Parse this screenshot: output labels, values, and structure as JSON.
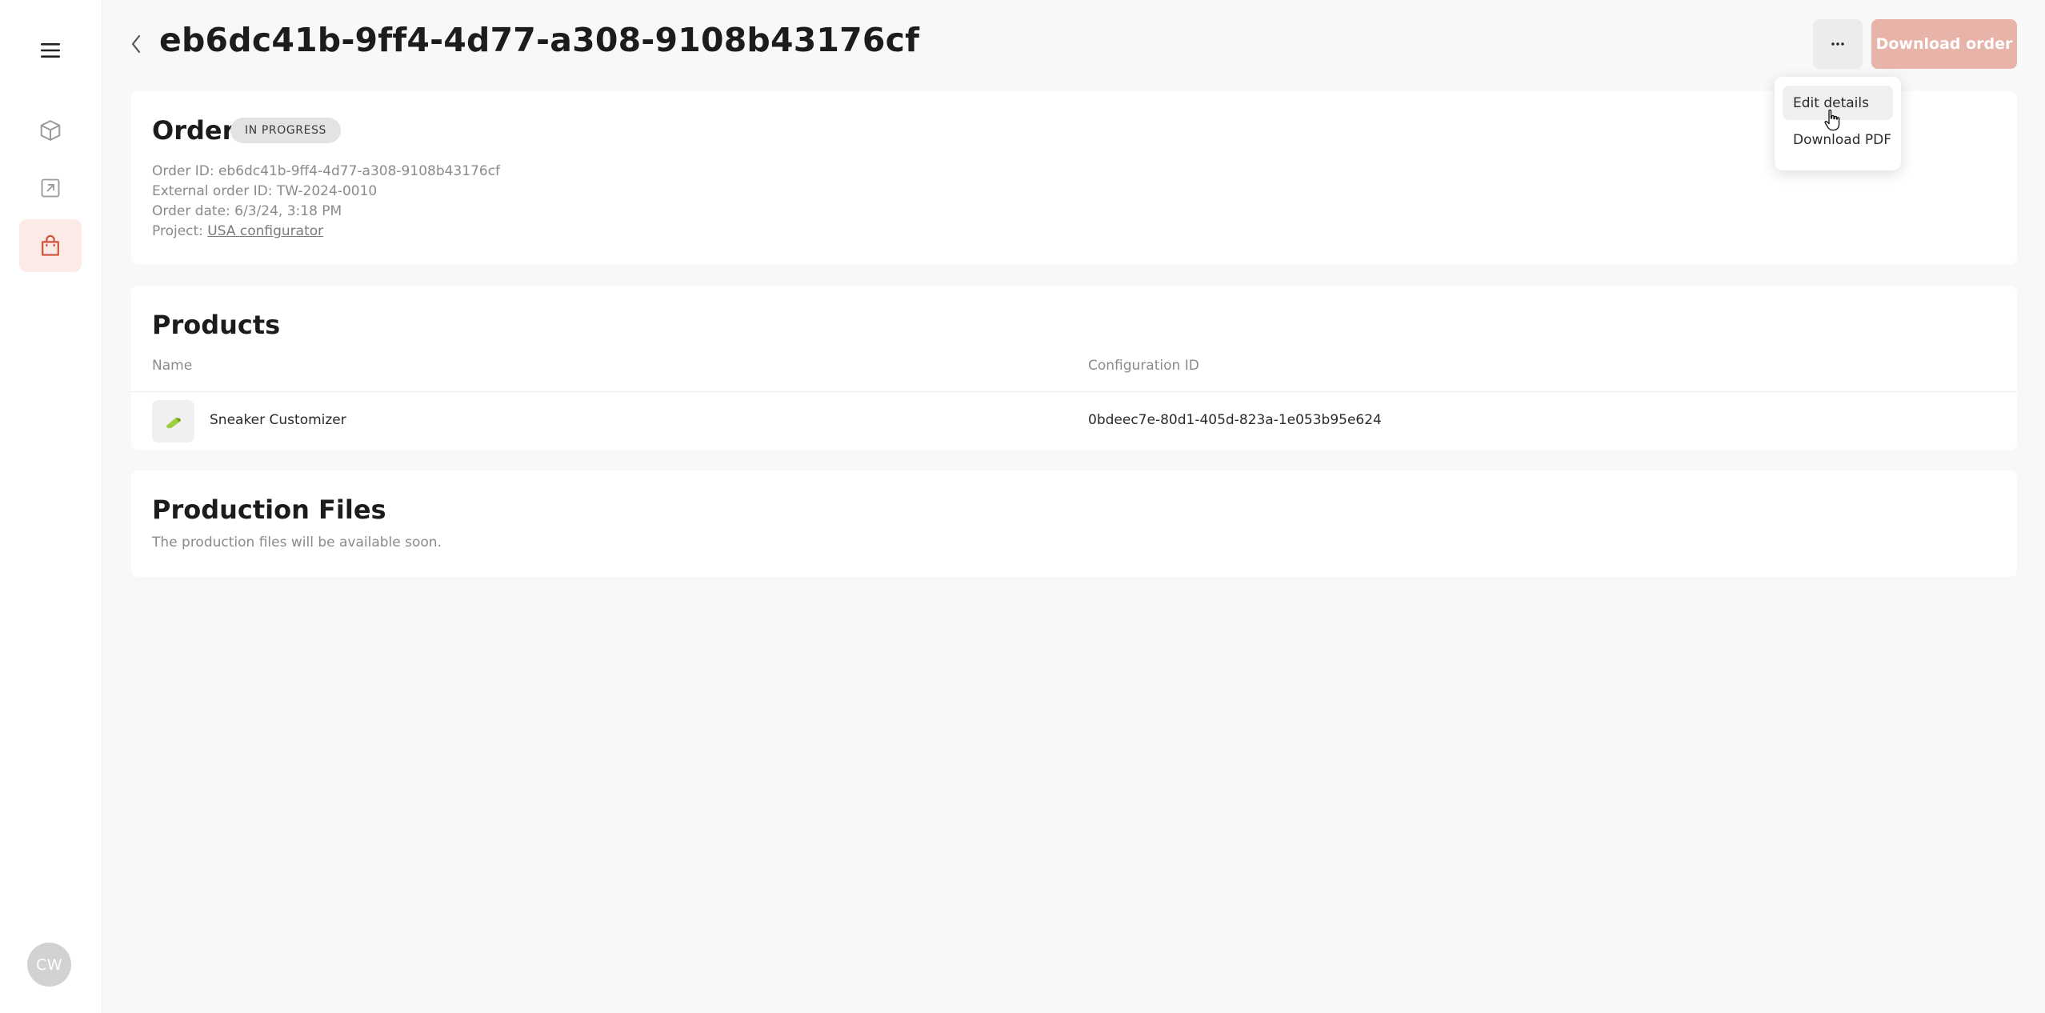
{
  "sidebar": {
    "menu_icon": "hamburger-menu-icon",
    "items": [
      {
        "icon": "cube-icon",
        "active": false
      },
      {
        "icon": "external-link-icon",
        "active": false
      },
      {
        "icon": "shopping-bag-icon",
        "active": true
      }
    ],
    "avatar_initials": "CW",
    "accent": "#d0523a"
  },
  "header": {
    "title": "eb6dc41b-9ff4-4d77-a308-9108b43176cf",
    "more_label": "···",
    "download_label": "Download order"
  },
  "dropdown": {
    "items": [
      {
        "label": "Edit details"
      },
      {
        "label": "Download PDF"
      }
    ]
  },
  "order": {
    "title": "Order",
    "status": "IN PROGRESS",
    "order_id_line": "Order ID: eb6dc41b-9ff4-4d77-a308-9108b43176cf",
    "external_id_line": "External order ID: TW-2024-0010",
    "date_line": "Order date: 6/3/24, 3:18 PM",
    "project_label": "Project: ",
    "project_link": "USA configurator"
  },
  "products": {
    "title": "Products",
    "columns": [
      "Name",
      "Configuration ID"
    ],
    "rows": [
      {
        "name": "Sneaker Customizer",
        "configuration_id": "0bdeec7e-80d1-405d-823a-1e053b95e624"
      }
    ]
  },
  "production_files": {
    "title": "Production Files",
    "note": "The production files will be available soon."
  }
}
